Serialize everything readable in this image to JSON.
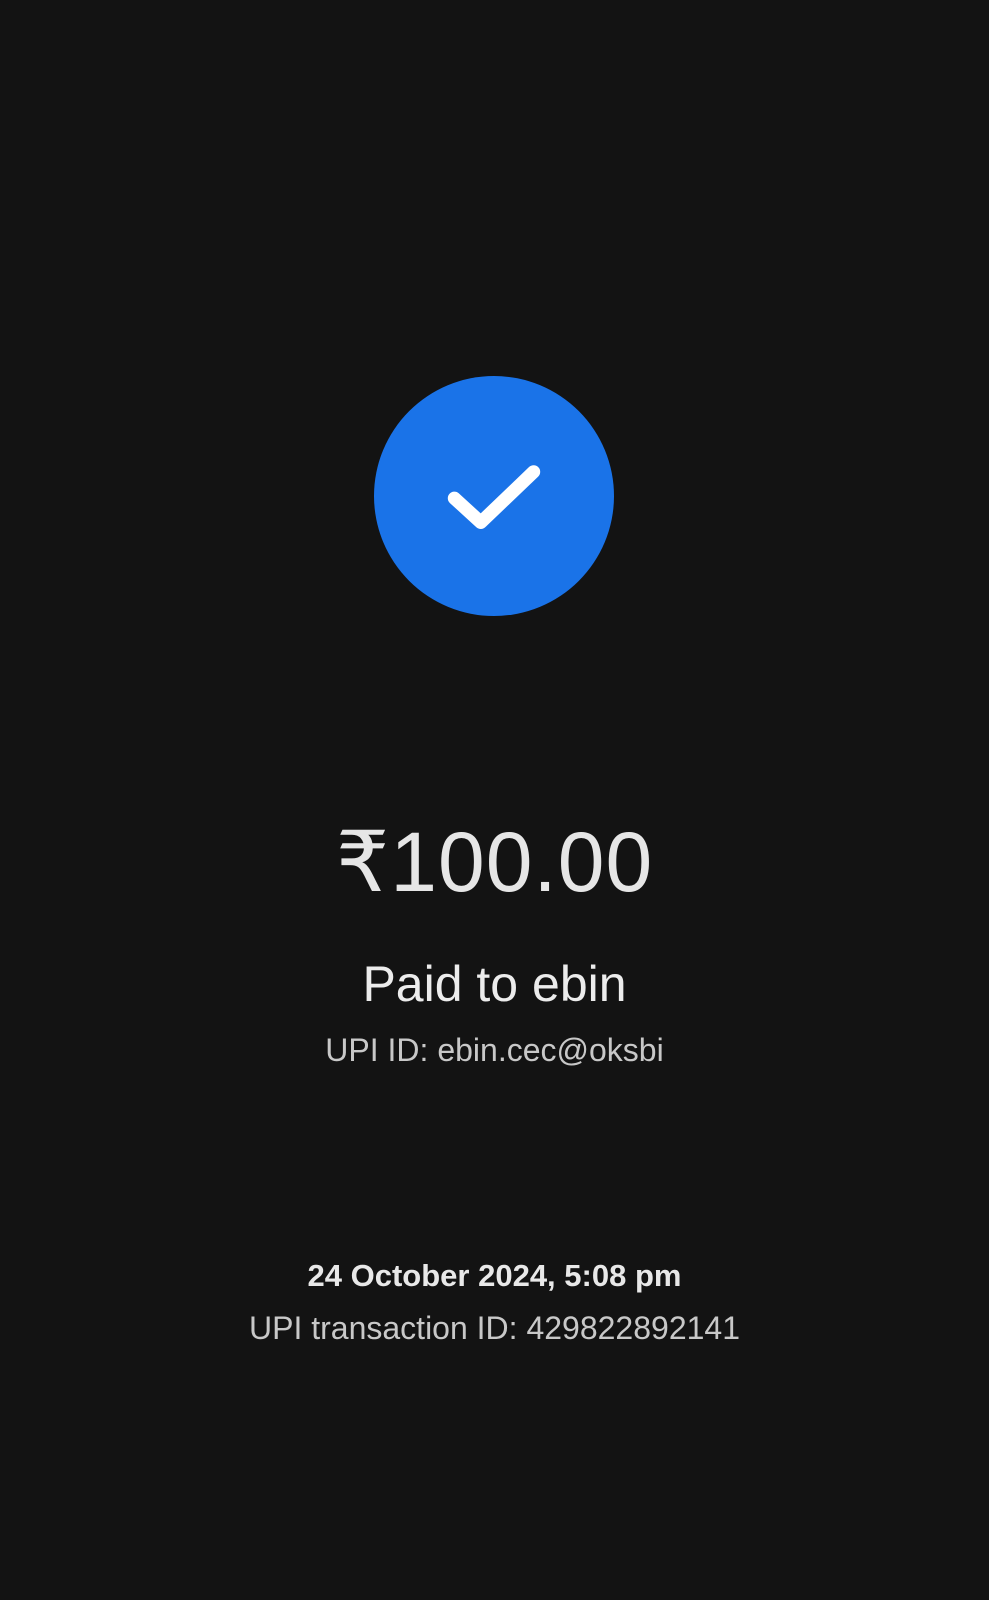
{
  "payment": {
    "amount": "₹100.00",
    "paid_to": "Paid to ebin",
    "upi_id": "UPI ID: ebin.cec@oksbi",
    "datetime": "24 October 2024, 5:08 pm",
    "transaction_id": "UPI transaction ID: 429822892141"
  },
  "icons": {
    "status": "checkmark-icon"
  },
  "colors": {
    "background": "#131313",
    "success_circle": "#1a73e8",
    "primary_text": "#e8e8e8",
    "secondary_text": "#c8c8c8"
  }
}
